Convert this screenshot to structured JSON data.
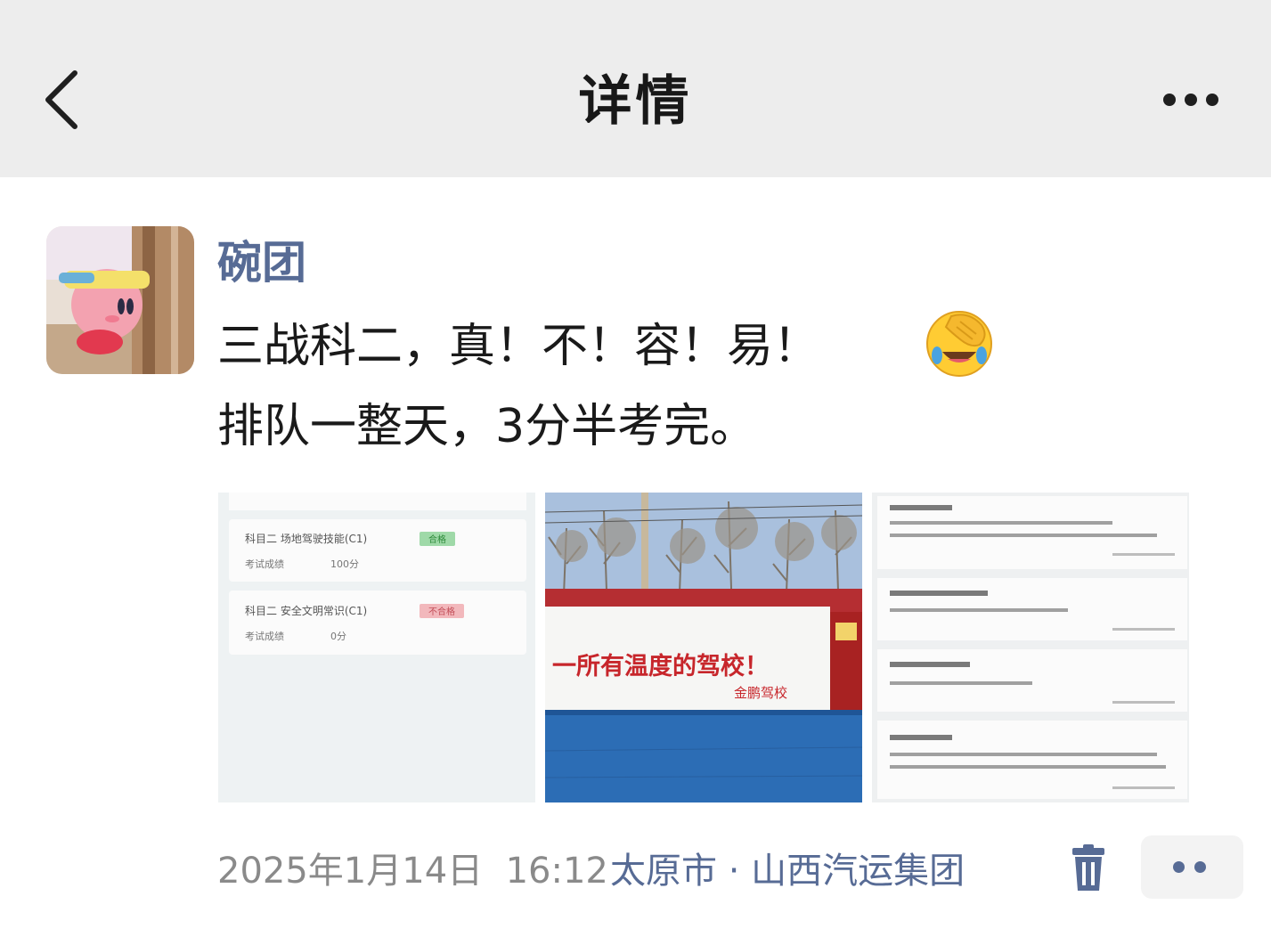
{
  "header": {
    "title": "详情",
    "back_icon": "chevron-left-icon",
    "more_icon": "more-dots-icon"
  },
  "post": {
    "author": "碗团",
    "text_line1": "三战科二，真！不！容！易！",
    "emoji": "facepalm-laughing-emoji",
    "text_line2": "排队一整天，3分半考完。",
    "images": [
      {
        "description": "app-score-screenshot",
        "rows": [
          {
            "title": "科目二 场地驾驶技能(C1)",
            "badge": "合格",
            "badge_color": "#9fd9a8",
            "score_label": "考试成绩",
            "score": "100分"
          },
          {
            "title": "科目二 安全文明常识(C1)",
            "badge": "不合格",
            "badge_color": "#f2b8bc",
            "score_label": "考试成绩",
            "score": "0分"
          }
        ]
      },
      {
        "description": "driving-school-sign-photo",
        "sign_text": "一所有温度的驾校！",
        "sign_subtext": "金鹏驾校"
      },
      {
        "description": "notification-list-screenshot"
      }
    ],
    "date": "2025年1月14日",
    "time": "16:12",
    "location": "太原市 · 山西汽运集团",
    "delete_icon": "trash-icon",
    "comment_icon": "comment-dots-icon"
  },
  "colors": {
    "header_bg": "#ededed",
    "author_link": "#576b95",
    "meta_gray": "#8a8a8a",
    "body_text": "#1a1a1a"
  }
}
